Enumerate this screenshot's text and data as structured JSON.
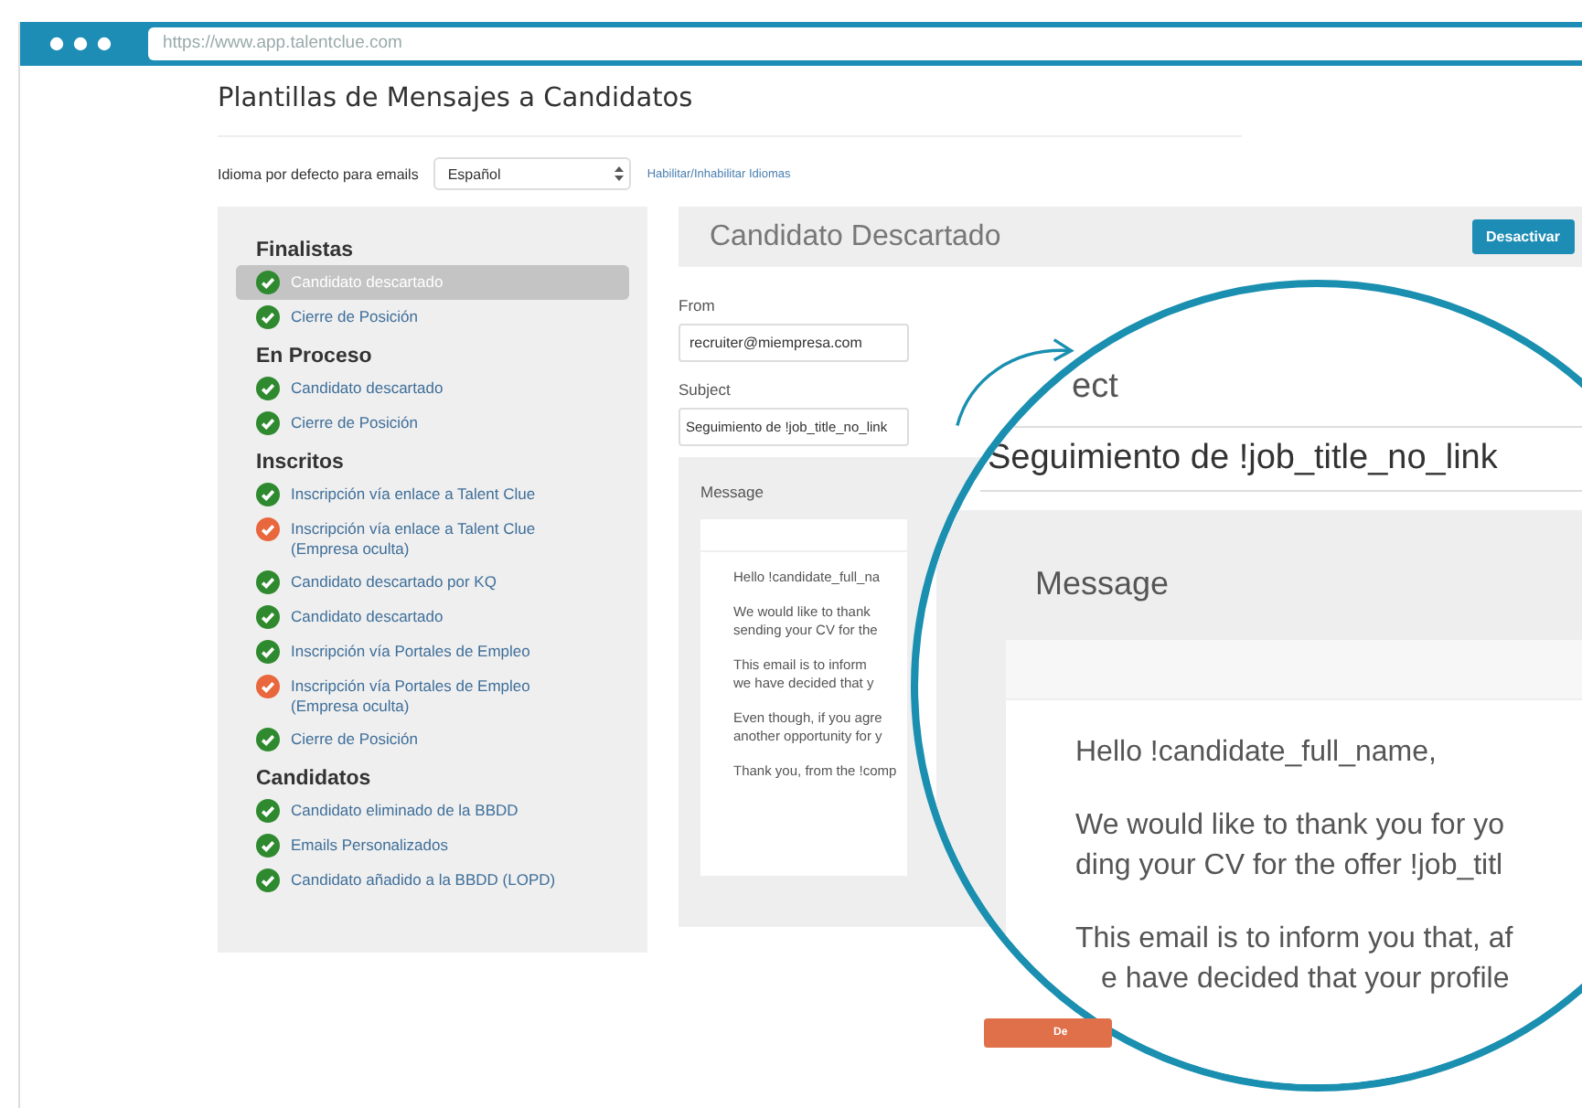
{
  "browser": {
    "url": "https://www.app.talentclue.com"
  },
  "page": {
    "title": "Plantillas de Mensajes a Candidatos"
  },
  "language": {
    "label": "Idioma por defecto para emails",
    "value": "Español",
    "link": "Habilitar/Inhabilitar Idiomas"
  },
  "sidebar": {
    "groups": [
      {
        "title": "Finalistas",
        "items": [
          {
            "label": "Candidato descartado",
            "selected": true,
            "color": "#2f8a2f"
          },
          {
            "label": "Cierre de Posición",
            "selected": false,
            "color": "#2f8a2f"
          }
        ]
      },
      {
        "title": "En Proceso",
        "items": [
          {
            "label": "Candidato descartado",
            "selected": false,
            "color": "#2f8a2f"
          },
          {
            "label": "Cierre de Posición",
            "selected": false,
            "color": "#2f8a2f"
          }
        ]
      },
      {
        "title": "Inscritos",
        "items": [
          {
            "label": "Inscripción vía enlace a Talent Clue",
            "selected": false,
            "color": "#2f8a2f"
          },
          {
            "label": "Inscripción vía enlace a Talent Clue (Empresa oculta)",
            "selected": false,
            "color": "#e8673d"
          },
          {
            "label": "Candidato descartado por KQ",
            "selected": false,
            "color": "#2f8a2f"
          },
          {
            "label": "Candidato descartado",
            "selected": false,
            "color": "#2f8a2f"
          },
          {
            "label": "Inscripción vía Portales de Empleo",
            "selected": false,
            "color": "#2f8a2f"
          },
          {
            "label": "Inscripción vía Portales de Empleo (Empresa oculta)",
            "selected": false,
            "color": "#e8673d"
          },
          {
            "label": "Cierre de Posición",
            "selected": false,
            "color": "#2f8a2f"
          }
        ]
      },
      {
        "title": "Candidatos",
        "items": [
          {
            "label": "Candidato eliminado de la BBDD",
            "selected": false,
            "color": "#2f8a2f"
          },
          {
            "label": "Emails Personalizados",
            "selected": false,
            "color": "#2f8a2f"
          },
          {
            "label": "Candidato añadido a la BBDD (LOPD)",
            "selected": false,
            "color": "#2f8a2f"
          }
        ]
      }
    ]
  },
  "editor": {
    "title": "Candidato Descartado",
    "button": "Desactivar",
    "from": {
      "label": "From",
      "value": "recruiter@miempresa.com"
    },
    "subject": {
      "label": "Subject",
      "value": "Seguimiento de !job_title_no_link"
    },
    "message": {
      "label": "Message",
      "paragraphs": [
        [
          "Hello !candidate_full_na"
        ],
        [
          "We would like to thank",
          "sending your CV for the"
        ],
        [
          "This email is to inform",
          "we have decided that y"
        ],
        [
          "Even though, if you agre",
          "another opportunity for y"
        ],
        [
          "Thank you, from the !comp"
        ]
      ]
    },
    "footer_button": "De"
  },
  "magnifier": {
    "subject_label": "ect",
    "subject_value": "Seguimiento de !job_title_no_link",
    "message_label": "Message",
    "paragraphs": [
      [
        "Hello !candidate_full_name,"
      ],
      [
        "We would like to thank you for yo",
        "ding your CV for the offer !job_titl"
      ],
      [
        "This email is to inform you that, af",
        "e have decided that your profile"
      ]
    ]
  }
}
